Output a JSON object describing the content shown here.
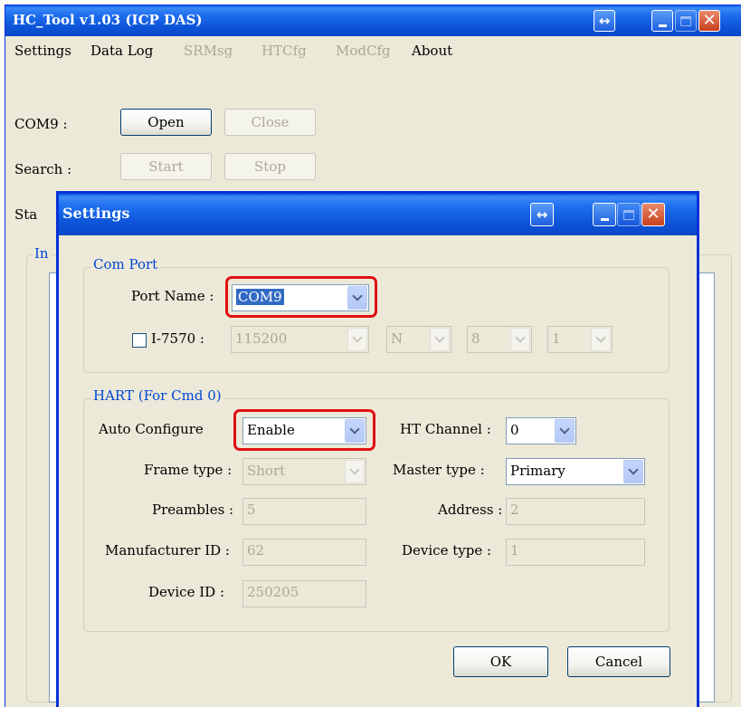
{
  "main_window": {
    "title": "HC_Tool v1.03  (ICP DAS)",
    "menu": [
      {
        "label": "Settings",
        "enabled": true
      },
      {
        "label": "Data Log",
        "enabled": true
      },
      {
        "label": "SRMsg",
        "enabled": false
      },
      {
        "label": "HTCfg",
        "enabled": false
      },
      {
        "label": "ModCfg",
        "enabled": false
      },
      {
        "label": "About",
        "enabled": true
      }
    ],
    "com_label": "COM9 :",
    "open_label": "Open",
    "close_label": "Close",
    "search_label": "Search :",
    "start_label": "Start",
    "stop_label": "Stop",
    "status_label_fragment": "Sta",
    "info_group_fragment": "In"
  },
  "dialog": {
    "title": "Settings",
    "com_port": {
      "group_label": "Com Port",
      "port_name_label": "Port Name :",
      "port_name_value": "COM9",
      "i7570_label": "I-7570 :",
      "i7570_checked": false,
      "baud_value": "115200",
      "parity_value": "N",
      "data_bits_value": "8",
      "stop_bits_value": "1"
    },
    "hart": {
      "group_label": "HART (For Cmd 0)",
      "auto_configure_label": "Auto Configure",
      "auto_configure_value": "Enable",
      "ht_channel_label": "HT Channel :",
      "ht_channel_value": "0",
      "frame_type_label": "Frame type :",
      "frame_type_value": "Short",
      "master_type_label": "Master type :",
      "master_type_value": "Primary",
      "preambles_label": "Preambles :",
      "preambles_value": "5",
      "address_label": "Address :",
      "address_value": "2",
      "manufacturer_id_label": "Manufacturer ID :",
      "manufacturer_id_value": "62",
      "device_type_label": "Device type :",
      "device_type_value": "1",
      "device_id_label": "Device ID :",
      "device_id_value": "250205"
    },
    "ok_label": "OK",
    "cancel_label": "Cancel"
  },
  "icons": {
    "restore": "double-arrow-icon",
    "minimize": "minimize-icon",
    "maximize": "maximize-icon",
    "close": "close-icon"
  },
  "colors": {
    "titlebar": "#0a5ce6",
    "window_bg": "#ece9d8",
    "highlight": "#e01010",
    "group_label": "#0046d5"
  }
}
